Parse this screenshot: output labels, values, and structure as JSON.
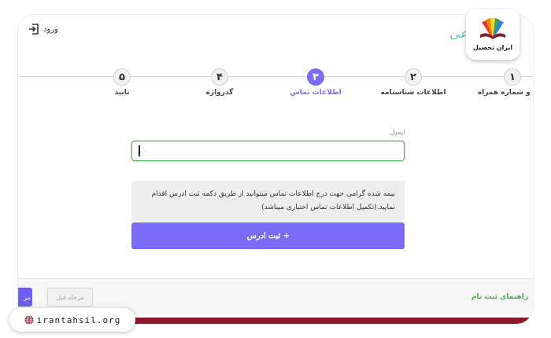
{
  "header": {
    "login_label": "ورود",
    "brand_partial": "جتماعی"
  },
  "stepper": {
    "steps": [
      {
        "number": "۱",
        "label": "ملی و شماره همراه",
        "state": "done"
      },
      {
        "number": "۲",
        "label": "اطلاعات شناسنامه",
        "state": "done"
      },
      {
        "number": "۳",
        "label": "اطلاعات تماس",
        "state": "active"
      },
      {
        "number": "۴",
        "label": "گذرواژه",
        "state": "pending"
      },
      {
        "number": "۵",
        "label": "تایید",
        "state": "pending"
      }
    ]
  },
  "form": {
    "email_label": "ایمیل",
    "email_value": "",
    "email_placeholder": "",
    "notice": "بیمه شده گرامی جهت درج اطلاعات تماس میتوانید از طریق دکمه ثبت ادرس اقدام نمایید.(تکمیل اطلاعات تماس اختیاری میباشد)",
    "submit_icon": "+",
    "submit_label": "ثبت ادرس"
  },
  "footer": {
    "guide_label": "راهنمای ثبت نام",
    "prev_label": "مرحله قبل",
    "next_label": "مر"
  },
  "watermark": {
    "logo_text": "ایران تحصیل",
    "site": "irantahsil.org"
  },
  "colors": {
    "accent": "#7a6cf5",
    "success": "#4caf50",
    "band": "#8b1a2b",
    "brand_teal": "#5cc6c9"
  }
}
